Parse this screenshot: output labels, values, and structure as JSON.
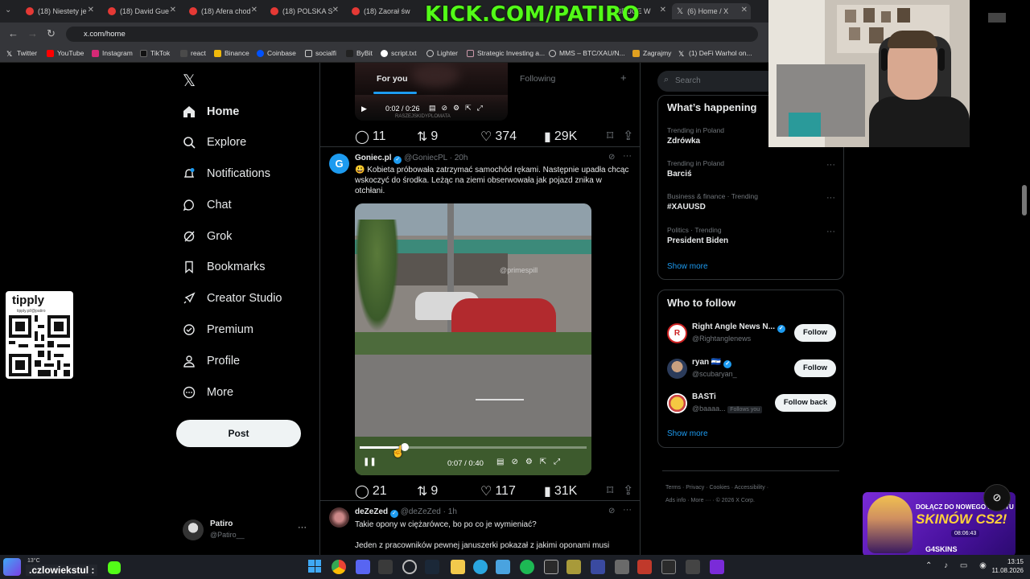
{
  "browser": {
    "tabs": [
      {
        "label": "(18) Niestety je"
      },
      {
        "label": "(18) David Gue"
      },
      {
        "label": "(18) Afera chod"
      },
      {
        "label": "(18) POLSKA S"
      },
      {
        "label": "(18) Zaorał św"
      },
      {
        "label": "BRUCE W"
      },
      {
        "label": "(6) Home / X"
      }
    ],
    "url": "x.com/home",
    "bookmarks": [
      "Twitter",
      "YouTube",
      "Instagram",
      "TikTok",
      "react",
      "Binance",
      "Coinbase",
      "socialfi",
      "ByBit",
      "script.txt",
      "Lighter",
      "Strategic Investing a...",
      "MMS – BTC/XAU/N...",
      "Zagrajmy",
      "(1) DeFi Warhol on..."
    ]
  },
  "overlay": {
    "kick_text": "KICK.COM/PATIRO",
    "tipply_label": "tipply",
    "tipply_sub": "tipply.pl/@patiro"
  },
  "nav": {
    "items": [
      {
        "label": "Home"
      },
      {
        "label": "Explore"
      },
      {
        "label": "Notifications"
      },
      {
        "label": "Chat"
      },
      {
        "label": "Grok"
      },
      {
        "label": "Bookmarks"
      },
      {
        "label": "Creator Studio"
      },
      {
        "label": "Premium"
      },
      {
        "label": "Profile"
      },
      {
        "label": "More"
      }
    ],
    "post_label": "Post",
    "account": {
      "name": "Patiro",
      "handle": "@Patiro__"
    }
  },
  "feed": {
    "tabs": {
      "for_you": "For you",
      "following": "Following"
    },
    "top_post": {
      "video_time": "0:02 / 0:26",
      "watermark": "RASZEJSKIDYPLOMATA",
      "replies": "11",
      "reposts": "9",
      "likes": "374",
      "views": "29K"
    },
    "post1": {
      "name": "Goniec.pl",
      "handle": "@GoniecPL",
      "time": "· 20h",
      "text": "😃 Kobieta próbowała zatrzymać samochód rękami. Następnie upadła chcąc wskoczyć do środka. Leżąc na ziemi obserwowała jak pojazd znika w otchłani.",
      "video_watermark": "@primespill",
      "video_time": "0:07 / 0:40",
      "video_progress": 0.2,
      "replies": "21",
      "reposts": "9",
      "likes": "117",
      "views": "31K"
    },
    "post2": {
      "name": "deZeZed",
      "handle": "@deZeZed",
      "time": "· 1h",
      "text1": "Takie opony w ciężarówce, bo po co je wymieniać?",
      "text2": "Jeden z pracowników pewnej januszerki pokazał z jakimi oponami musi"
    }
  },
  "right": {
    "search_placeholder": "Search",
    "happening_title": "What’s happening",
    "trends": [
      {
        "context": "Trending in Poland",
        "topic": "Zdrówka"
      },
      {
        "context": "Trending in Poland",
        "topic": "Barciś"
      },
      {
        "context": "Business & finance · Trending",
        "topic": "#XAUUSD"
      },
      {
        "context": "Politics · Trending",
        "topic": "President Biden"
      }
    ],
    "show_more": "Show more",
    "who_title": "Who to follow",
    "follows": [
      {
        "name": "Right Angle News N...",
        "handle": "@Rightanglenews",
        "button": "Follow"
      },
      {
        "name": "ryan 🇸🇻",
        "handle": "@scubaryan_",
        "button": "Follow"
      },
      {
        "name": "BASTi",
        "handle": "@baaaa...",
        "badge": "Follows you",
        "button": "Follow back"
      }
    ],
    "show_more2": "Show more",
    "footer": [
      "Terms",
      "Privacy",
      "Cookies",
      "Accessibility",
      "Ads info",
      "More ···",
      "© 2026 X Corp."
    ]
  },
  "ad": {
    "line1": "DOŁĄCZ DO NOWEGO EVENTU",
    "line2": "SKINÓW CS2!",
    "timer": "08:06:43",
    "brand": "G4SKINS"
  },
  "taskbar": {
    "weather": "13°C",
    "ticker": ".czlowiekstul :",
    "time": "13:15",
    "date": "11.08.2026"
  },
  "colors": {
    "accent": "#1d9bf0",
    "kick": "#53fc18",
    "bg": "#000000"
  }
}
